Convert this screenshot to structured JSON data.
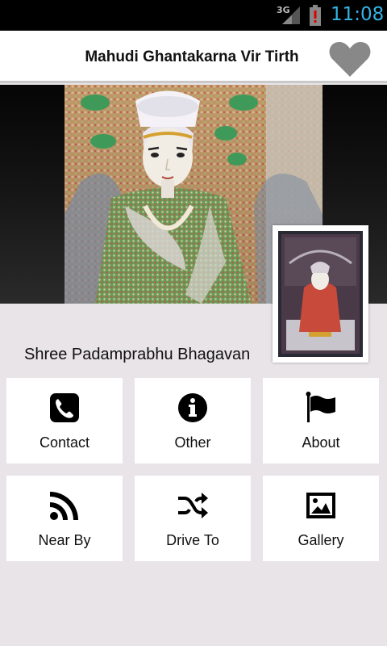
{
  "status_bar": {
    "network": "3G",
    "time": "11:08",
    "icons": [
      "signal-icon",
      "battery-alert-icon"
    ]
  },
  "app_bar": {
    "title": "Mahudi Ghantakarna Vir Tirth",
    "favorite_icon": "heart-icon"
  },
  "temple": {
    "deity_name": "Shree Padamprabhu Bhagavan"
  },
  "menu": [
    {
      "label": "Contact",
      "icon": "phone-icon"
    },
    {
      "label": "Other",
      "icon": "info-icon"
    },
    {
      "label": "About",
      "icon": "flag-icon"
    },
    {
      "label": "Near By",
      "icon": "rss-icon"
    },
    {
      "label": "Drive To",
      "icon": "shuffle-icon"
    },
    {
      "label": "Gallery",
      "icon": "image-icon"
    }
  ],
  "colors": {
    "status_bar_bg": "#000000",
    "clock": "#33b5e5",
    "heart": "#888888",
    "page_bg": "#e8e4e7",
    "tile_bg": "#ffffff"
  }
}
